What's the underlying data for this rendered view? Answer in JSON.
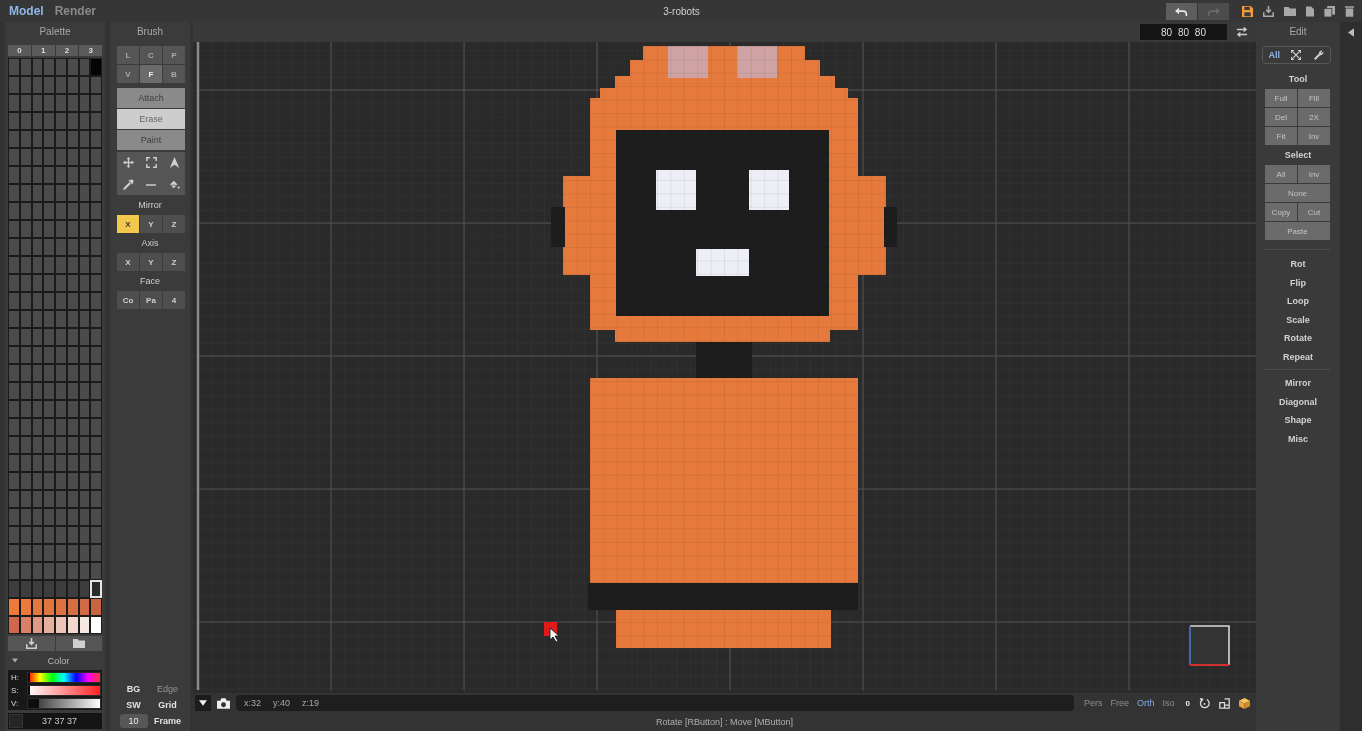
{
  "top_bar": {
    "modes": [
      {
        "label": "Model",
        "selected": true
      },
      {
        "label": "Render",
        "selected": false
      }
    ],
    "title": "3-robots",
    "history": {
      "undo_disabled": false,
      "redo_disabled": true
    }
  },
  "palette": {
    "title": "Palette",
    "pages": [
      "0",
      "1",
      "2",
      "3"
    ],
    "rows": [
      [
        {
          "color": "#4b4b4b",
          "selected": false
        },
        {
          "color": "#4b4b4b",
          "selected": false
        },
        {
          "color": "#4b4b4b",
          "selected": false
        },
        {
          "color": "#4b4b4b",
          "selected": false
        },
        {
          "color": "#4b4b4b",
          "selected": false
        },
        {
          "color": "#4b4b4b",
          "selected": false
        },
        {
          "color": "#4b4b4b",
          "selected": false
        },
        {
          "color": "#050505",
          "selected": false
        }
      ],
      [
        {
          "color": "#4b4b4b",
          "selected": false
        },
        {
          "color": "#4b4b4b",
          "selected": false
        },
        {
          "color": "#4b4b4b",
          "selected": false
        },
        {
          "color": "#4b4b4b",
          "selected": false
        },
        {
          "color": "#4b4b4b",
          "selected": false
        },
        {
          "color": "#4b4b4b",
          "selected": false
        },
        {
          "color": "#4b4b4b",
          "selected": false
        },
        {
          "color": "#4b4b4b",
          "selected": false
        }
      ],
      [
        {
          "color": "#4b4b4b",
          "selected": false
        },
        {
          "color": "#4b4b4b",
          "selected": false
        },
        {
          "color": "#4b4b4b",
          "selected": false
        },
        {
          "color": "#4b4b4b",
          "selected": false
        },
        {
          "color": "#4b4b4b",
          "selected": false
        },
        {
          "color": "#4b4b4b",
          "selected": false
        },
        {
          "color": "#4b4b4b",
          "selected": false
        },
        {
          "color": "#4b4b4b",
          "selected": false
        }
      ],
      [
        {
          "color": "#4b4b4b",
          "selected": false
        },
        {
          "color": "#4b4b4b",
          "selected": false
        },
        {
          "color": "#4b4b4b",
          "selected": false
        },
        {
          "color": "#4b4b4b",
          "selected": false
        },
        {
          "color": "#4b4b4b",
          "selected": false
        },
        {
          "color": "#4b4b4b",
          "selected": false
        },
        {
          "color": "#4b4b4b",
          "selected": false
        },
        {
          "color": "#4b4b4b",
          "selected": false
        }
      ],
      [
        {
          "color": "#4b4b4b",
          "selected": false
        },
        {
          "color": "#4b4b4b",
          "selected": false
        },
        {
          "color": "#4b4b4b",
          "selected": false
        },
        {
          "color": "#4b4b4b",
          "selected": false
        },
        {
          "color": "#4b4b4b",
          "selected": false
        },
        {
          "color": "#4b4b4b",
          "selected": false
        },
        {
          "color": "#4b4b4b",
          "selected": false
        },
        {
          "color": "#4b4b4b",
          "selected": false
        }
      ],
      [
        {
          "color": "#4b4b4b",
          "selected": false
        },
        {
          "color": "#4b4b4b",
          "selected": false
        },
        {
          "color": "#4b4b4b",
          "selected": false
        },
        {
          "color": "#4b4b4b",
          "selected": false
        },
        {
          "color": "#4b4b4b",
          "selected": false
        },
        {
          "color": "#4b4b4b",
          "selected": false
        },
        {
          "color": "#4b4b4b",
          "selected": false
        },
        {
          "color": "#4b4b4b",
          "selected": false
        }
      ],
      [
        {
          "color": "#4b4b4b",
          "selected": false
        },
        {
          "color": "#4b4b4b",
          "selected": false
        },
        {
          "color": "#4b4b4b",
          "selected": false
        },
        {
          "color": "#4b4b4b",
          "selected": false
        },
        {
          "color": "#4b4b4b",
          "selected": false
        },
        {
          "color": "#4b4b4b",
          "selected": false
        },
        {
          "color": "#4b4b4b",
          "selected": false
        },
        {
          "color": "#4b4b4b",
          "selected": false
        }
      ],
      [
        {
          "color": "#4b4b4b",
          "selected": false
        },
        {
          "color": "#4b4b4b",
          "selected": false
        },
        {
          "color": "#4b4b4b",
          "selected": false
        },
        {
          "color": "#4b4b4b",
          "selected": false
        },
        {
          "color": "#4b4b4b",
          "selected": false
        },
        {
          "color": "#4b4b4b",
          "selected": false
        },
        {
          "color": "#4b4b4b",
          "selected": false
        },
        {
          "color": "#4b4b4b",
          "selected": false
        }
      ],
      [
        {
          "color": "#4b4b4b",
          "selected": false
        },
        {
          "color": "#4b4b4b",
          "selected": false
        },
        {
          "color": "#4b4b4b",
          "selected": false
        },
        {
          "color": "#4b4b4b",
          "selected": false
        },
        {
          "color": "#4b4b4b",
          "selected": false
        },
        {
          "color": "#4b4b4b",
          "selected": false
        },
        {
          "color": "#4b4b4b",
          "selected": false
        },
        {
          "color": "#4b4b4b",
          "selected": false
        }
      ],
      [
        {
          "color": "#4b4b4b",
          "selected": false
        },
        {
          "color": "#4b4b4b",
          "selected": false
        },
        {
          "color": "#4b4b4b",
          "selected": false
        },
        {
          "color": "#4b4b4b",
          "selected": false
        },
        {
          "color": "#4b4b4b",
          "selected": false
        },
        {
          "color": "#4b4b4b",
          "selected": false
        },
        {
          "color": "#4b4b4b",
          "selected": false
        },
        {
          "color": "#4b4b4b",
          "selected": false
        }
      ],
      [
        {
          "color": "#4b4b4b",
          "selected": false
        },
        {
          "color": "#4b4b4b",
          "selected": false
        },
        {
          "color": "#4b4b4b",
          "selected": false
        },
        {
          "color": "#4b4b4b",
          "selected": false
        },
        {
          "color": "#4b4b4b",
          "selected": false
        },
        {
          "color": "#4b4b4b",
          "selected": false
        },
        {
          "color": "#4b4b4b",
          "selected": false
        },
        {
          "color": "#4b4b4b",
          "selected": false
        }
      ],
      [
        {
          "color": "#4b4b4b",
          "selected": false
        },
        {
          "color": "#4b4b4b",
          "selected": false
        },
        {
          "color": "#4b4b4b",
          "selected": false
        },
        {
          "color": "#4b4b4b",
          "selected": false
        },
        {
          "color": "#4b4b4b",
          "selected": false
        },
        {
          "color": "#4b4b4b",
          "selected": false
        },
        {
          "color": "#4b4b4b",
          "selected": false
        },
        {
          "color": "#4b4b4b",
          "selected": false
        }
      ],
      [
        {
          "color": "#4b4b4b",
          "selected": false
        },
        {
          "color": "#4b4b4b",
          "selected": false
        },
        {
          "color": "#4b4b4b",
          "selected": false
        },
        {
          "color": "#4b4b4b",
          "selected": false
        },
        {
          "color": "#4b4b4b",
          "selected": false
        },
        {
          "color": "#4b4b4b",
          "selected": false
        },
        {
          "color": "#4b4b4b",
          "selected": false
        },
        {
          "color": "#4b4b4b",
          "selected": false
        }
      ],
      [
        {
          "color": "#4b4b4b",
          "selected": false
        },
        {
          "color": "#4b4b4b",
          "selected": false
        },
        {
          "color": "#4b4b4b",
          "selected": false
        },
        {
          "color": "#4b4b4b",
          "selected": false
        },
        {
          "color": "#4b4b4b",
          "selected": false
        },
        {
          "color": "#4b4b4b",
          "selected": false
        },
        {
          "color": "#4b4b4b",
          "selected": false
        },
        {
          "color": "#4b4b4b",
          "selected": false
        }
      ],
      [
        {
          "color": "#4b4b4b",
          "selected": false
        },
        {
          "color": "#4b4b4b",
          "selected": false
        },
        {
          "color": "#4b4b4b",
          "selected": false
        },
        {
          "color": "#4b4b4b",
          "selected": false
        },
        {
          "color": "#4b4b4b",
          "selected": false
        },
        {
          "color": "#4b4b4b",
          "selected": false
        },
        {
          "color": "#4b4b4b",
          "selected": false
        },
        {
          "color": "#4b4b4b",
          "selected": false
        }
      ],
      [
        {
          "color": "#4b4b4b",
          "selected": false
        },
        {
          "color": "#4b4b4b",
          "selected": false
        },
        {
          "color": "#4b4b4b",
          "selected": false
        },
        {
          "color": "#4b4b4b",
          "selected": false
        },
        {
          "color": "#4b4b4b",
          "selected": false
        },
        {
          "color": "#4b4b4b",
          "selected": false
        },
        {
          "color": "#4b4b4b",
          "selected": false
        },
        {
          "color": "#4b4b4b",
          "selected": false
        }
      ],
      [
        {
          "color": "#4b4b4b",
          "selected": false
        },
        {
          "color": "#4b4b4b",
          "selected": false
        },
        {
          "color": "#4b4b4b",
          "selected": false
        },
        {
          "color": "#4b4b4b",
          "selected": false
        },
        {
          "color": "#4b4b4b",
          "selected": false
        },
        {
          "color": "#4b4b4b",
          "selected": false
        },
        {
          "color": "#4b4b4b",
          "selected": false
        },
        {
          "color": "#4b4b4b",
          "selected": false
        }
      ],
      [
        {
          "color": "#4b4b4b",
          "selected": false
        },
        {
          "color": "#4b4b4b",
          "selected": false
        },
        {
          "color": "#4b4b4b",
          "selected": false
        },
        {
          "color": "#4b4b4b",
          "selected": false
        },
        {
          "color": "#4b4b4b",
          "selected": false
        },
        {
          "color": "#4b4b4b",
          "selected": false
        },
        {
          "color": "#4b4b4b",
          "selected": false
        },
        {
          "color": "#4b4b4b",
          "selected": false
        }
      ],
      [
        {
          "color": "#4b4b4b",
          "selected": false
        },
        {
          "color": "#4b4b4b",
          "selected": false
        },
        {
          "color": "#4b4b4b",
          "selected": false
        },
        {
          "color": "#4b4b4b",
          "selected": false
        },
        {
          "color": "#4b4b4b",
          "selected": false
        },
        {
          "color": "#4b4b4b",
          "selected": false
        },
        {
          "color": "#4b4b4b",
          "selected": false
        },
        {
          "color": "#4b4b4b",
          "selected": false
        }
      ],
      [
        {
          "color": "#4b4b4b",
          "selected": false
        },
        {
          "color": "#4b4b4b",
          "selected": false
        },
        {
          "color": "#4b4b4b",
          "selected": false
        },
        {
          "color": "#4b4b4b",
          "selected": false
        },
        {
          "color": "#4b4b4b",
          "selected": false
        },
        {
          "color": "#4b4b4b",
          "selected": false
        },
        {
          "color": "#4b4b4b",
          "selected": false
        },
        {
          "color": "#4b4b4b",
          "selected": false
        }
      ],
      [
        {
          "color": "#4b4b4b",
          "selected": false
        },
        {
          "color": "#4b4b4b",
          "selected": false
        },
        {
          "color": "#4b4b4b",
          "selected": false
        },
        {
          "color": "#4b4b4b",
          "selected": false
        },
        {
          "color": "#4b4b4b",
          "selected": false
        },
        {
          "color": "#4b4b4b",
          "selected": false
        },
        {
          "color": "#4b4b4b",
          "selected": false
        },
        {
          "color": "#4b4b4b",
          "selected": false
        }
      ],
      [
        {
          "color": "#4b4b4b",
          "selected": false
        },
        {
          "color": "#4b4b4b",
          "selected": false
        },
        {
          "color": "#4b4b4b",
          "selected": false
        },
        {
          "color": "#4b4b4b",
          "selected": false
        },
        {
          "color": "#4b4b4b",
          "selected": false
        },
        {
          "color": "#4b4b4b",
          "selected": false
        },
        {
          "color": "#4b4b4b",
          "selected": false
        },
        {
          "color": "#4b4b4b",
          "selected": false
        }
      ],
      [
        {
          "color": "#4b4b4b",
          "selected": false
        },
        {
          "color": "#4b4b4b",
          "selected": false
        },
        {
          "color": "#4b4b4b",
          "selected": false
        },
        {
          "color": "#4b4b4b",
          "selected": false
        },
        {
          "color": "#4b4b4b",
          "selected": false
        },
        {
          "color": "#4b4b4b",
          "selected": false
        },
        {
          "color": "#4b4b4b",
          "selected": false
        },
        {
          "color": "#4b4b4b",
          "selected": false
        }
      ],
      [
        {
          "color": "#4b4b4b",
          "selected": false
        },
        {
          "color": "#4b4b4b",
          "selected": false
        },
        {
          "color": "#4b4b4b",
          "selected": false
        },
        {
          "color": "#4b4b4b",
          "selected": false
        },
        {
          "color": "#4b4b4b",
          "selected": false
        },
        {
          "color": "#4b4b4b",
          "selected": false
        },
        {
          "color": "#4b4b4b",
          "selected": false
        },
        {
          "color": "#4b4b4b",
          "selected": false
        }
      ],
      [
        {
          "color": "#4b4b4b",
          "selected": false
        },
        {
          "color": "#4b4b4b",
          "selected": false
        },
        {
          "color": "#4b4b4b",
          "selected": false
        },
        {
          "color": "#4b4b4b",
          "selected": false
        },
        {
          "color": "#4b4b4b",
          "selected": false
        },
        {
          "color": "#4b4b4b",
          "selected": false
        },
        {
          "color": "#4b4b4b",
          "selected": false
        },
        {
          "color": "#4b4b4b",
          "selected": false
        }
      ],
      [
        {
          "color": "#4b4b4b",
          "selected": false
        },
        {
          "color": "#4b4b4b",
          "selected": false
        },
        {
          "color": "#4b4b4b",
          "selected": false
        },
        {
          "color": "#4b4b4b",
          "selected": false
        },
        {
          "color": "#4b4b4b",
          "selected": false
        },
        {
          "color": "#4b4b4b",
          "selected": false
        },
        {
          "color": "#4b4b4b",
          "selected": false
        },
        {
          "color": "#4b4b4b",
          "selected": false
        }
      ],
      [
        {
          "color": "#4b4b4b",
          "selected": false
        },
        {
          "color": "#4b4b4b",
          "selected": false
        },
        {
          "color": "#4b4b4b",
          "selected": false
        },
        {
          "color": "#4b4b4b",
          "selected": false
        },
        {
          "color": "#4b4b4b",
          "selected": false
        },
        {
          "color": "#4b4b4b",
          "selected": false
        },
        {
          "color": "#4b4b4b",
          "selected": false
        },
        {
          "color": "#4b4b4b",
          "selected": false
        }
      ],
      [
        {
          "color": "#4b4b4b",
          "selected": false
        },
        {
          "color": "#4b4b4b",
          "selected": false
        },
        {
          "color": "#4b4b4b",
          "selected": false
        },
        {
          "color": "#4b4b4b",
          "selected": false
        },
        {
          "color": "#4b4b4b",
          "selected": false
        },
        {
          "color": "#4b4b4b",
          "selected": false
        },
        {
          "color": "#4b4b4b",
          "selected": false
        },
        {
          "color": "#4b4b4b",
          "selected": false
        }
      ],
      [
        {
          "color": "#4b4b4b",
          "selected": false
        },
        {
          "color": "#4b4b4b",
          "selected": false
        },
        {
          "color": "#4b4b4b",
          "selected": false
        },
        {
          "color": "#4b4b4b",
          "selected": false
        },
        {
          "color": "#4b4b4b",
          "selected": false
        },
        {
          "color": "#4b4b4b",
          "selected": false
        },
        {
          "color": "#4b4b4b",
          "selected": false
        },
        {
          "color": "#4b4b4b",
          "selected": false
        }
      ],
      [
        {
          "color": "#3d3d3d",
          "selected": false
        },
        {
          "color": "#3d3d3d",
          "selected": false
        },
        {
          "color": "#3d3d3d",
          "selected": false
        },
        {
          "color": "#3d3d3d",
          "selected": false
        },
        {
          "color": "#3d3d3d",
          "selected": false
        },
        {
          "color": "#3d3d3d",
          "selected": false
        },
        {
          "color": "#3d3d3d",
          "selected": false
        },
        {
          "color": "#2b2b2b",
          "selected": true
        }
      ],
      [
        {
          "color": "#ec7a3a",
          "selected": false
        },
        {
          "color": "#e97a3c",
          "selected": false
        },
        {
          "color": "#e5783e",
          "selected": false
        },
        {
          "color": "#e17540",
          "selected": false
        },
        {
          "color": "#dd7242",
          "selected": false
        },
        {
          "color": "#d86f43",
          "selected": false
        },
        {
          "color": "#d26a43",
          "selected": false
        },
        {
          "color": "#c96443",
          "selected": false
        }
      ],
      [
        {
          "color": "#d0674d",
          "selected": false
        },
        {
          "color": "#d88068",
          "selected": false
        },
        {
          "color": "#df9985",
          "selected": false
        },
        {
          "color": "#e6b09f",
          "selected": false
        },
        {
          "color": "#ecc4b8",
          "selected": false
        },
        {
          "color": "#f1d7ce",
          "selected": false
        },
        {
          "color": "#f6e8e3",
          "selected": false
        },
        {
          "color": "#ffffff",
          "selected": false
        }
      ]
    ]
  },
  "palette_color": {
    "title": "Color",
    "expanded": true,
    "channels": [
      {
        "label": "H:",
        "level": 0
      },
      {
        "label": "S:",
        "level": 0
      },
      {
        "label": "V:",
        "level": 0.15
      }
    ],
    "current": {
      "color": "#252525",
      "value": "37 37 37"
    }
  },
  "brush": {
    "title": "Brush",
    "modes": [
      {
        "label": "L",
        "selected": false
      },
      {
        "label": "C",
        "selected": false
      },
      {
        "label": "P",
        "selected": false
      },
      {
        "label": "V",
        "selected": false
      },
      {
        "label": "F",
        "selected": true
      },
      {
        "label": "B",
        "selected": false
      }
    ],
    "actions": [
      {
        "label": "Attach",
        "selected": false
      },
      {
        "label": "Erase",
        "selected": true
      },
      {
        "label": "Paint",
        "selected": false
      }
    ],
    "mirror": {
      "label": "Mirror",
      "axes": [
        {
          "label": "X",
          "selected": true
        },
        {
          "label": "Y",
          "selected": false
        },
        {
          "label": "Z",
          "selected": false
        }
      ]
    },
    "axis": {
      "label": "Axis",
      "axes": [
        "X",
        "Y",
        "Z"
      ]
    },
    "face": {
      "label": "Face",
      "options": [
        "Co",
        "Pa",
        "4"
      ]
    }
  },
  "display": {
    "toggles": [
      {
        "label": "BG",
        "on": true
      },
      {
        "label": "Edge",
        "on": false
      },
      {
        "label": "SW",
        "on": true
      },
      {
        "label": "Grid",
        "on": true
      },
      {
        "label": "Frame",
        "on": true
      }
    ],
    "number_field": "10"
  },
  "viewport": {
    "dimensions": "80 80 80",
    "coordinates": [
      "x:32",
      "y:40",
      "z:19"
    ],
    "camera_modes": [
      {
        "label": "Pers",
        "selected": false
      },
      {
        "label": "Free",
        "selected": false
      },
      {
        "label": "Orth",
        "selected": true
      },
      {
        "label": "Iso",
        "selected": false
      }
    ],
    "camera_value": "0"
  },
  "edit": {
    "title": "Edit",
    "scope_tabs": [
      {
        "label": "All",
        "selected": true
      }
    ],
    "tool": {
      "label": "Tool",
      "buttons": [
        "Full",
        "Fill",
        "Del",
        "2X",
        "Fit",
        "Inv"
      ]
    },
    "select": {
      "label": "Select",
      "rows": [
        [
          "All",
          "Inv"
        ],
        [
          "None"
        ],
        [
          "Copy",
          "Cut"
        ],
        [
          "Paste"
        ]
      ]
    },
    "transforms": [
      "Rot",
      "Flip",
      "Loop",
      "Scale",
      "Rotate",
      "Repeat"
    ],
    "more": [
      "Mirror",
      "Diagonal",
      "Shape",
      "Misc"
    ]
  },
  "status_bar": "Rotate [RButton] : Move [MButton]"
}
